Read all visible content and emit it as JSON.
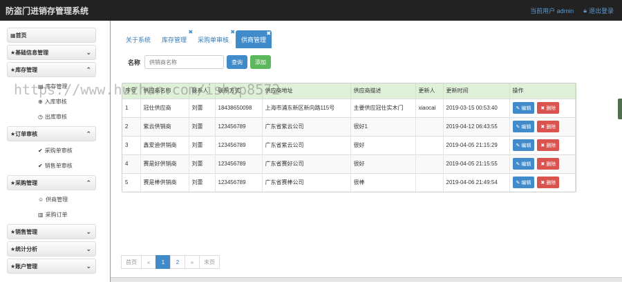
{
  "app": {
    "title": "防盗门进销存管理系统"
  },
  "topbar": {
    "user_label": "当前用户 admin",
    "logout_label": "退出登录"
  },
  "sidebar": {
    "home": "首页",
    "basic": "基础信息管理",
    "inventory": {
      "label": "库存管理",
      "items": [
        "库存管理",
        "入库审核",
        "出库审核"
      ]
    },
    "orders": {
      "label": "订单审核",
      "items": [
        "采购单审核",
        "销售单审核"
      ]
    },
    "purchase": {
      "label": "采购管理",
      "items": [
        "供商管理",
        "采购订单"
      ]
    },
    "sales": "销售管理",
    "stats": "统计分析",
    "account": "账户管理"
  },
  "tabs": [
    {
      "label": "关于系统"
    },
    {
      "label": "库存管理"
    },
    {
      "label": "采购单审核"
    },
    {
      "label": "供商管理"
    }
  ],
  "search": {
    "label": "名称",
    "placeholder": "供销商名称",
    "query_label": "查询",
    "add_label": "添加"
  },
  "table": {
    "headers": [
      "序号",
      "供应商名称",
      "联系人",
      "联系方式",
      "供应商地址",
      "供应商描述",
      "更新人",
      "更新时间",
      "操作"
    ],
    "edit_label": "编辑",
    "delete_label": "删除",
    "rows": [
      [
        "1",
        "冠仕供应商",
        "刘蕾",
        "18438650098",
        "上海市浦东新区新向路115号",
        "主要供应冠仕实木门",
        "xiaocai",
        "2019-03-15 00:53:40"
      ],
      [
        "2",
        "紫云供销商",
        "刘蕾",
        "123456789",
        "广东省紫云公司",
        "很好1",
        "",
        "2019-04-12 06:43:55"
      ],
      [
        "3",
        "鑫爱迪供销商",
        "刘蕾",
        "123456789",
        "广东省紫云公司",
        "很好",
        "",
        "2019-04-05 21:15:29"
      ],
      [
        "4",
        "赛是好供销商",
        "刘蕾",
        "123456789",
        "广东省赛好公司",
        "很好",
        "",
        "2019-04-05 21:15:55"
      ],
      [
        "5",
        "赛是棒供销商",
        "刘蕾",
        "123456789",
        "广东省赛棒公司",
        "很棒",
        "",
        "2019-04-06 21:49:54"
      ]
    ]
  },
  "pager": {
    "first": "首页",
    "prev": "«",
    "pages": [
      "1",
      "2"
    ],
    "next": "»",
    "last": "末页"
  },
  "watermark": "https://www.huzhan.com/ishop8572",
  "colors": {
    "primary": "#428bca",
    "success": "#5cb85c",
    "danger": "#d9534f",
    "header_green": "#dff0d8"
  }
}
